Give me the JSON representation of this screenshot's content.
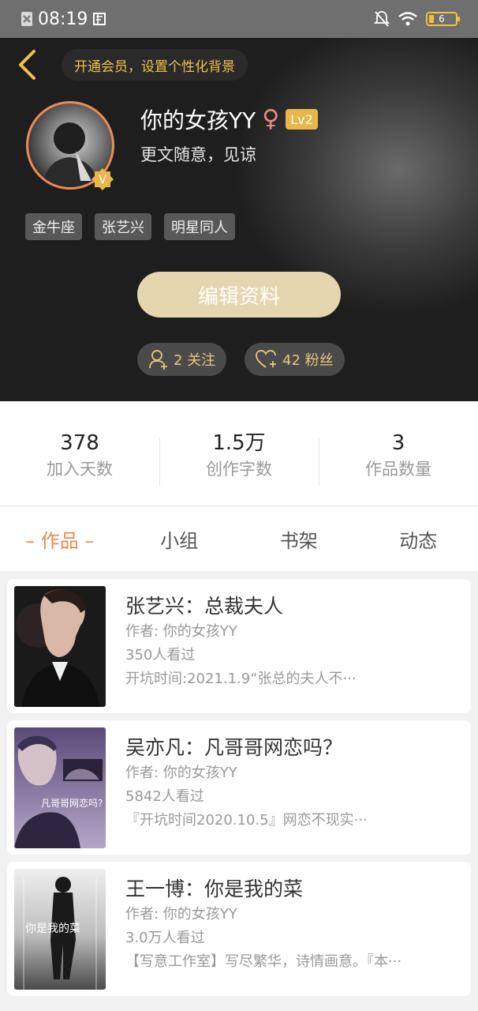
{
  "status_bar": {
    "time": "08:19",
    "battery": "6",
    "accent": "#f2c23a"
  },
  "header": {
    "vip_prompt": "开通会员，设置个性化背景",
    "username": "你的女孩YY",
    "gender_symbol": "♀",
    "level": "Lv2",
    "bio": "更文随意，见谅",
    "avatar_badge": "V",
    "tags": [
      "金牛座",
      "张艺兴",
      "明星同人"
    ],
    "edit_label": "编辑资料",
    "following_label": "2 关注",
    "followers_label": "42 粉丝"
  },
  "stats": [
    {
      "value": "378",
      "label": "加入天数"
    },
    {
      "value": "1.5万",
      "label": "创作字数"
    },
    {
      "value": "3",
      "label": "作品数量"
    }
  ],
  "tabs": [
    "– 作品 –",
    "小组",
    "书架",
    "动态"
  ],
  "works": [
    {
      "title": "张艺兴：总裁夫人",
      "author": "作者: 你的女孩YY",
      "views": "350人看过",
      "desc": "开坑时间:2021.1.9“张总的夫人不···"
    },
    {
      "title": "吴亦凡：凡哥哥网恋吗？",
      "author": "作者: 你的女孩YY",
      "views": "5842人看过",
      "desc": "『开坑时间2020.10.5』网恋不现实···",
      "cover_text": "凡哥哥网恋吗?"
    },
    {
      "title": "王一博：你是我的菜",
      "author": "作者: 你的女孩YY",
      "views": "3.0万人看过",
      "desc": "【写意工作室】写尽繁华，诗情画意。『本···",
      "cover_text": "你是我的菜"
    }
  ],
  "colors": {
    "accent_orange": "#e88a50",
    "gold": "#f1c24a",
    "edit_button": "#e6d6b0",
    "female_symbol": "#ee8a7a"
  }
}
